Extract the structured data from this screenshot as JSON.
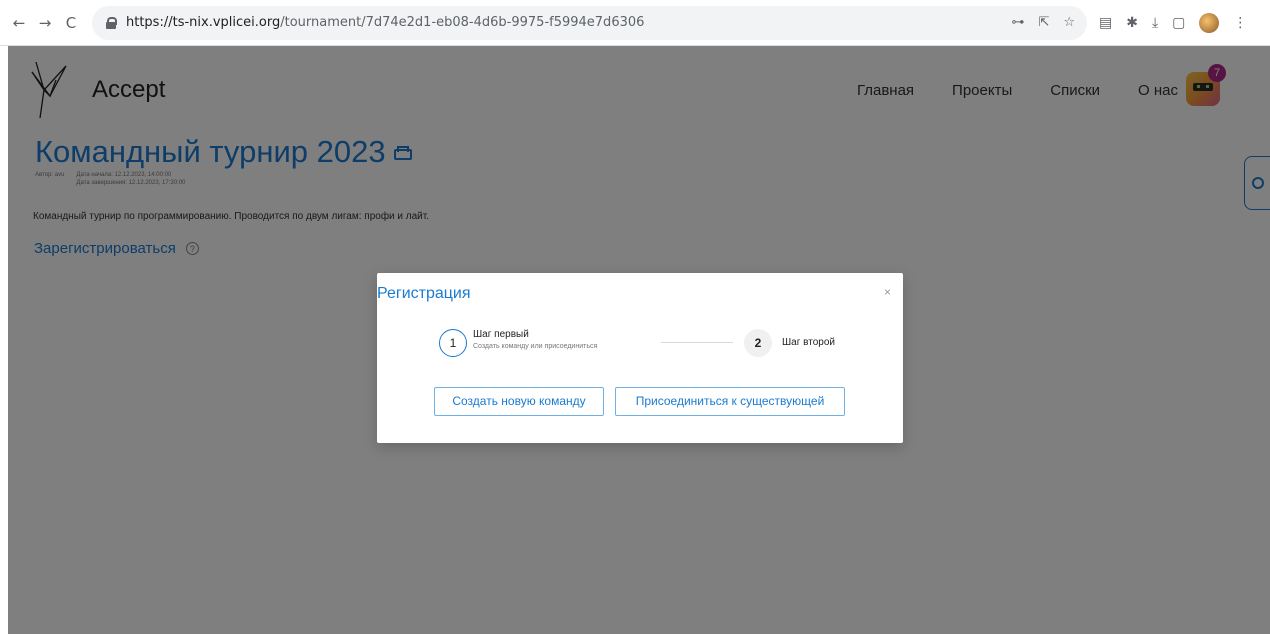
{
  "browser": {
    "back_icon": "←",
    "forward_icon": "→",
    "reload_icon": "C",
    "url_host": "https://ts-nix.vplicei.org",
    "url_path": "/tournament/7d74e2d1-eb08-4d6b-9975-f5994e7d6306",
    "key_icon": "⊶",
    "share_icon": "⇱",
    "star_icon": "☆",
    "download_icon": "⤓",
    "sidepanel_icon": "▢",
    "menu_icon": "⋮"
  },
  "site": {
    "brand": "Accept",
    "nav": [
      "Главная",
      "Проекты",
      "Списки",
      "О нас"
    ],
    "notification_count": "7"
  },
  "tournament": {
    "title": "Командный турнир 2023",
    "author": "Автор: avu",
    "start_date": "Дата начала: 12.12.2023, 14:00:00",
    "end_date": "Дата завершения: 12.12.2023, 17:30:00",
    "description": "Командный турнир по программированию. Проводится по двум лигам: профи и лайт.",
    "register_label": "Зарегистрироваться",
    "help_symbol": "?"
  },
  "modal": {
    "title": "Регистрация",
    "close": "×",
    "step1_number": "1",
    "step1_title": "Шаг первый",
    "step1_desc": "Создать команду или присоединиться",
    "step2_number": "2",
    "step2_title": "Шаг второй",
    "create_button": "Создать новую команду",
    "join_button": "Присоединиться к существующей"
  },
  "colors": {
    "accent": "#1a7bd0",
    "overlay": "rgba(0,0,0,0.5)",
    "badge": "#b0278b"
  }
}
